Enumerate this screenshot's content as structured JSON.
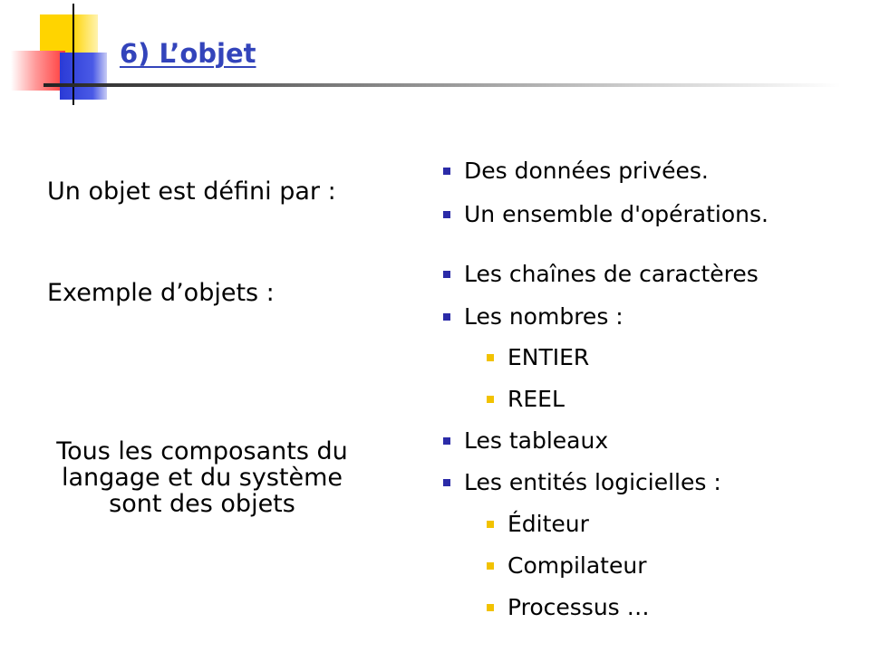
{
  "slide": {
    "title": "6) L’objet",
    "left": [
      "Un objet est défini par :",
      "Exemple d’objets :",
      "Tous les composants du langage et du système sont des objets"
    ],
    "definition_items": [
      "Des données privées.",
      "Un ensemble d'opérations."
    ],
    "example_items": [
      "Les chaînes de caractères",
      "Les nombres :",
      "ENTIER",
      "REEL",
      "Les tableaux",
      "Les entités logicielles :",
      "Éditeur",
      "Compilateur",
      "Processus …"
    ]
  },
  "colors": {
    "title": "#3344bb",
    "bullet_level1": "#2b2ba8",
    "bullet_level2": "#f2c200"
  }
}
